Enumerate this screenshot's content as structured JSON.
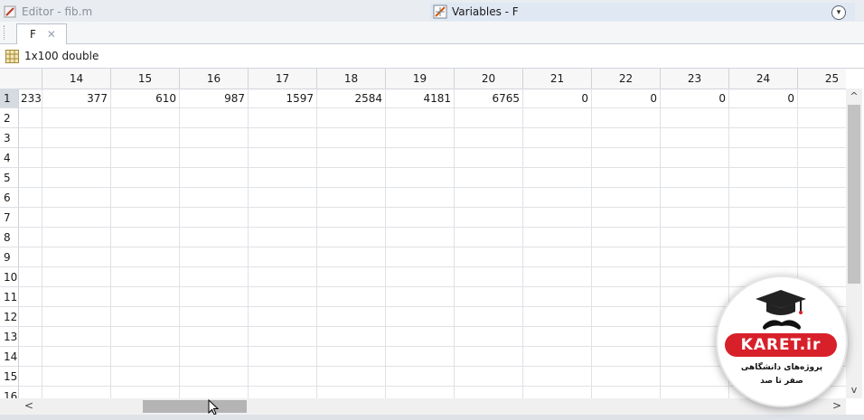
{
  "window": {
    "editor_title": "Editor - fib.m",
    "variables_title": "Variables - F"
  },
  "tabs": [
    {
      "label": "F",
      "close": "✕"
    }
  ],
  "info": {
    "size_label": "1x100 double"
  },
  "table": {
    "columns": [
      "14",
      "15",
      "16",
      "17",
      "18",
      "19",
      "20",
      "21",
      "22",
      "23",
      "24",
      "25"
    ],
    "rows": [
      "1",
      "2",
      "3",
      "4",
      "5",
      "6",
      "7",
      "8",
      "9",
      "10",
      "11",
      "12",
      "13",
      "14",
      "15",
      "16"
    ],
    "row1_partial": "233",
    "row1_values": [
      "377",
      "610",
      "987",
      "1597",
      "2584",
      "4181",
      "6765",
      "0",
      "0",
      "0",
      "0",
      ""
    ]
  },
  "scroll": {
    "up": "^",
    "down": "v",
    "left": "<",
    "right": ">"
  },
  "watermark": {
    "brand": "KARET.ir",
    "line1": "پروژه‌های دانشگاهی",
    "line2": "صفر تا صد"
  },
  "colors": {
    "selected_row": "#d6dbe1",
    "brand_red": "#d8202a"
  }
}
